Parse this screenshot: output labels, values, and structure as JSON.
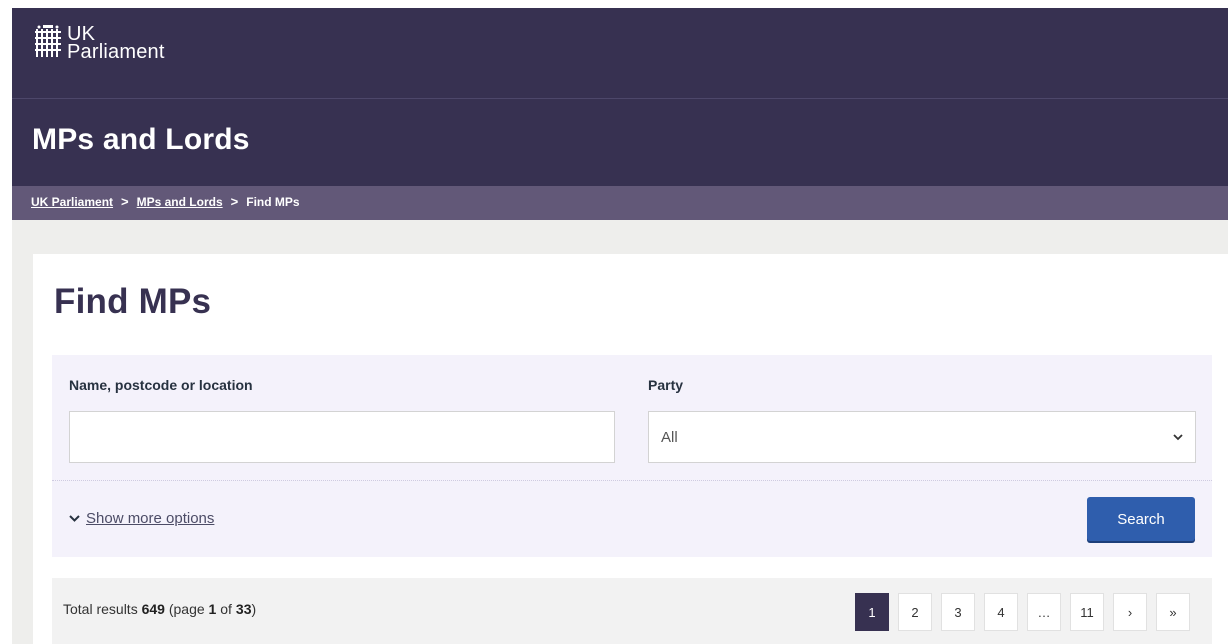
{
  "header": {
    "logo_line1": "UK",
    "logo_line2": "Parliament",
    "section_title": "MPs and Lords"
  },
  "breadcrumb": {
    "items": [
      "UK Parliament",
      "MPs and Lords",
      "Find MPs"
    ],
    "separator": ">"
  },
  "main": {
    "title": "Find MPs"
  },
  "filters": {
    "name_label": "Name, postcode or location",
    "name_value": "",
    "name_placeholder": "",
    "party_label": "Party",
    "party_selected": "All",
    "more_options_label": "Show more options",
    "search_button": "Search"
  },
  "results": {
    "prefix": "Total results",
    "total": "649",
    "page_prefix": "(page",
    "page": "1",
    "of": "of",
    "pages": "33",
    "suffix": ")"
  },
  "pagination": {
    "items": [
      "1",
      "2",
      "3",
      "4",
      "…",
      "11",
      "›",
      "»"
    ],
    "current": "1"
  },
  "colors": {
    "brand": "#373151",
    "breadcrumb_bar": "#625878",
    "search_button": "#2f5ead",
    "filter_panel": "#f4f2fb"
  },
  "icons": [
    "portcullis-logo",
    "chevron-down-icon"
  ]
}
